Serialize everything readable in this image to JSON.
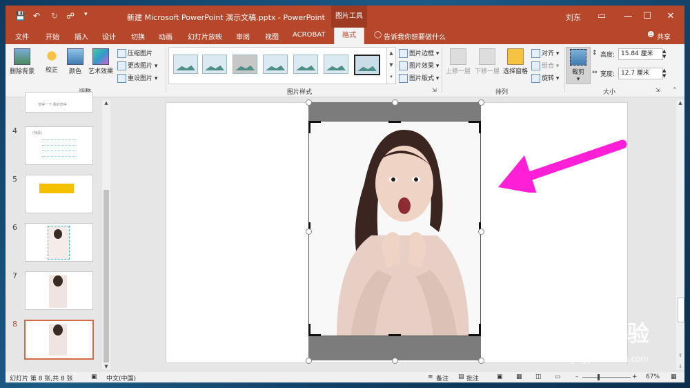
{
  "title": {
    "document": "新建 Microsoft PowerPoint 演示文稿.pptx  -  PowerPoint",
    "context_tab": "图片工具",
    "user": "刘东"
  },
  "tabs": [
    "文件",
    "开始",
    "插入",
    "设计",
    "切换",
    "动画",
    "幻灯片放映",
    "审阅",
    "视图",
    "ACROBAT",
    "格式"
  ],
  "tell_me": "告诉我你想要做什么",
  "share": "共享",
  "ribbon": {
    "adjust": {
      "remove_bg": "删除背景",
      "correct": "校正",
      "color": "颜色",
      "artistic": "艺术效果",
      "compress": "压缩图片",
      "change": "更改图片",
      "reset": "重设图片",
      "label": "调整"
    },
    "styles": {
      "border": "图片边框",
      "effects": "图片效果",
      "layout": "图片版式",
      "label": "图片样式"
    },
    "arrange": {
      "forward": "上移一层",
      "backward": "下移一层",
      "selection_pane": "选择窗格",
      "align": "对齐",
      "group": "组合",
      "rotate": "旋转",
      "label": "排列"
    },
    "size": {
      "crop": "裁剪",
      "height_label": "高度:",
      "height_value": "15.84 厘米",
      "width_label": "宽度:",
      "width_value": "12.7 厘米",
      "label": "大小"
    }
  },
  "slides": [
    {
      "num": "4",
      "text": "(我是)"
    },
    {
      "num": "5",
      "text": ""
    },
    {
      "num": "6",
      "text": ""
    },
    {
      "num": "7",
      "text": ""
    },
    {
      "num": "8",
      "text": ""
    }
  ],
  "partial_slide_text": "觉得一下,我的觉得",
  "status": {
    "slide_info": "幻灯片 第 8 张,共 8 张",
    "language": "中文(中国)",
    "notes": "备注",
    "comments": "批注",
    "zoom": "67%"
  },
  "watermark": {
    "brand": "Baidu经验",
    "url": "jingyan.baidu.com"
  },
  "colors": {
    "accent": "#b7472a",
    "arrow": "#ff1fd6"
  }
}
